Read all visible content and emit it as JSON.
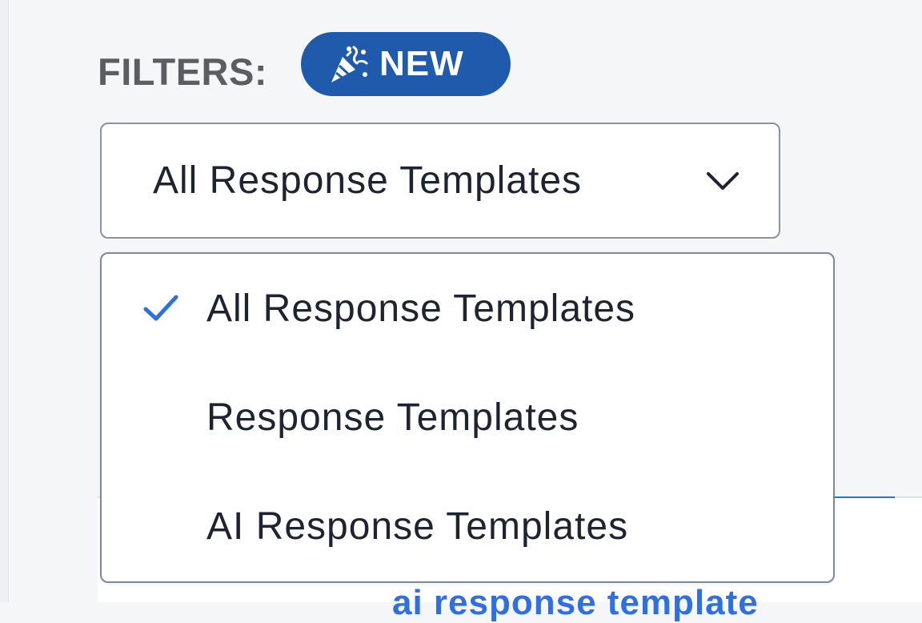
{
  "filters": {
    "label": "FILTERS:",
    "badge_label": "NEW",
    "badge_icon": "party-popper-icon",
    "badge_color": "#1f5aad"
  },
  "select": {
    "value": "All Response Templates",
    "icon": "chevron-down-icon"
  },
  "menu": {
    "items": [
      {
        "label": "All Response Templates",
        "selected": true
      },
      {
        "label": "Response Templates",
        "selected": false
      },
      {
        "label": "AI Response Templates",
        "selected": false
      }
    ],
    "check_icon": "checkmark-icon",
    "check_color": "#2f6fe0"
  },
  "background": {
    "partial_link_text": "ai response template",
    "accent_color": "#2f6fe0"
  }
}
